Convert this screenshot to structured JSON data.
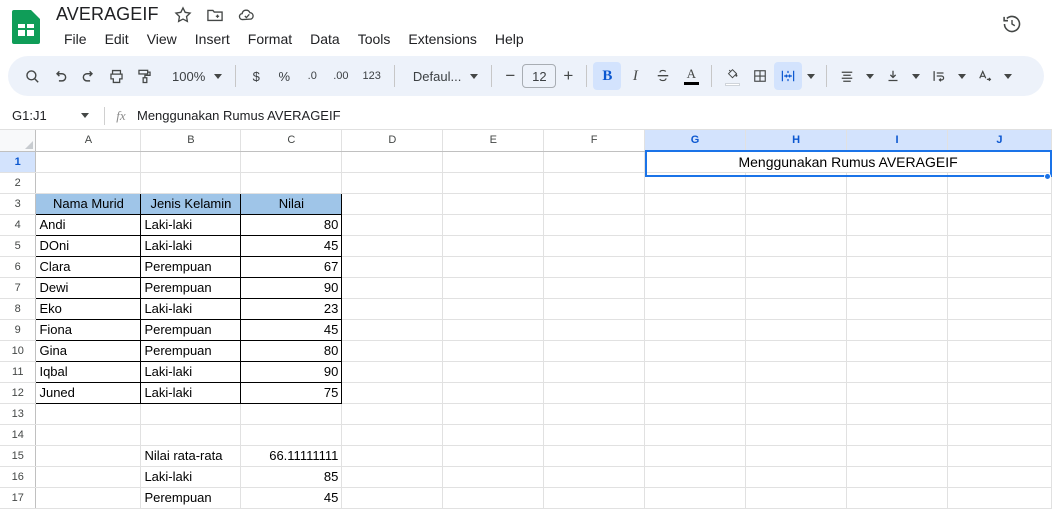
{
  "app": {
    "doc_title": "AVERAGEIF",
    "logo_icon": "sheets-logo-icon",
    "title_icons": [
      "star-icon",
      "move-to-folder-icon",
      "cloud-saved-icon"
    ],
    "history_icon": "version-history-icon"
  },
  "menu": {
    "items": [
      "File",
      "Edit",
      "View",
      "Insert",
      "Format",
      "Data",
      "Tools",
      "Extensions",
      "Help"
    ]
  },
  "toolbar": {
    "search_icon": "search-icon",
    "undo_icon": "undo-icon",
    "redo_icon": "redo-icon",
    "print_icon": "print-icon",
    "paint_format_icon": "paint-format-icon",
    "zoom_value": "100%",
    "currency_label": "$",
    "percent_label": "%",
    "decrease_decimal_label": ".0",
    "increase_decimal_label": ".00",
    "more_formats_label": "123",
    "font_name": "Defaul...",
    "font_size": "12",
    "decrease_font_label": "−",
    "increase_font_label": "+",
    "bold_label": "B",
    "italic_label": "I",
    "strikethrough_icon": "strikethrough-icon",
    "text_color_label": "A",
    "fill_color_icon": "fill-color-icon",
    "borders_icon": "borders-icon",
    "merge_cells_icon": "merge-cells-icon",
    "horizontal_align_icon": "horizontal-align-icon",
    "vertical_align_icon": "vertical-align-icon",
    "text_wrap_icon": "text-wrap-icon",
    "text_rotation_icon": "text-rotation-icon"
  },
  "formula_bar": {
    "name_box": "G1:J1",
    "fx_label": "fx",
    "formula_value": "Menggunakan Rumus AVERAGEIF"
  },
  "grid": {
    "columns": [
      "A",
      "B",
      "C",
      "D",
      "E",
      "F",
      "G",
      "H",
      "I",
      "J"
    ],
    "selected_columns": [
      "G",
      "H",
      "I",
      "J"
    ],
    "rows": [
      "1",
      "2",
      "3",
      "4",
      "5",
      "6",
      "7",
      "8",
      "9",
      "10",
      "11",
      "12",
      "13",
      "14",
      "15",
      "16",
      "17"
    ],
    "selected_rows": [
      "1"
    ],
    "merged_title_cell": {
      "range": "G1:J1",
      "text": "Menggunakan Rumus AVERAGEIF"
    },
    "table_headers": [
      "Nama Murid",
      "Jenis Kelamin",
      "Nilai"
    ],
    "table_rows": [
      {
        "row": "4",
        "nama": "Andi",
        "jenis": "Laki-laki",
        "nilai": "80"
      },
      {
        "row": "5",
        "nama": "DOni",
        "jenis": "Laki-laki",
        "nilai": "45"
      },
      {
        "row": "6",
        "nama": "Clara",
        "jenis": "Perempuan",
        "nilai": "67"
      },
      {
        "row": "7",
        "nama": "Dewi",
        "jenis": "Perempuan",
        "nilai": "90"
      },
      {
        "row": "8",
        "nama": "Eko",
        "jenis": "Laki-laki",
        "nilai": "23"
      },
      {
        "row": "9",
        "nama": "Fiona",
        "jenis": "Perempuan",
        "nilai": "45"
      },
      {
        "row": "10",
        "nama": "Gina",
        "jenis": "Perempuan",
        "nilai": "80"
      },
      {
        "row": "11",
        "nama": "Iqbal",
        "jenis": "Laki-laki",
        "nilai": "90"
      },
      {
        "row": "12",
        "nama": "Juned",
        "jenis": "Laki-laki",
        "nilai": "75"
      }
    ],
    "summary_rows": [
      {
        "row": "15",
        "label": "Nilai rata-rata",
        "value": "66.11111111"
      },
      {
        "row": "16",
        "label": "Laki-laki",
        "value": "85"
      },
      {
        "row": "17",
        "label": "Perempuan",
        "value": "45"
      }
    ]
  },
  "colors": {
    "accent": "#1a73e8",
    "selected_header": "#d3e3fd",
    "table_header_fill": "#9fc5e8",
    "toolbar_bg": "#edf2fa",
    "logo_green": "#0f9d58"
  }
}
